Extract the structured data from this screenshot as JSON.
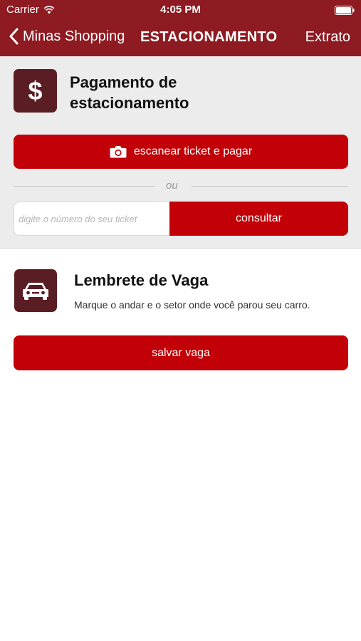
{
  "status_bar": {
    "carrier": "Carrier",
    "time": "4:05 PM"
  },
  "nav": {
    "back_label": "Minas Shopping",
    "title": "ESTACIONAMENTO",
    "extrato": "Extrato"
  },
  "payment": {
    "icon_symbol": "$",
    "title": "Pagamento de estacionamento",
    "scan_button": "escanear ticket e pagar",
    "divider_text": "ou",
    "ticket_placeholder": "digite o número do seu ticket",
    "ticket_value": "",
    "consult_button": "consultar"
  },
  "reminder": {
    "title": "Lembrete de Vaga",
    "description": "Marque o andar e o setor onde você parou seu carro.",
    "save_button": "salvar vaga"
  },
  "colors": {
    "nav_bg": "#8e1b22",
    "button_red": "#c10007",
    "icon_box": "#5a1d23",
    "section_bg": "#ececec"
  },
  "icons": {
    "wifi": "wifi-icon",
    "battery": "battery-icon",
    "back": "chevron-left-icon",
    "dollar": "dollar-icon",
    "camera": "camera-icon",
    "car": "car-icon"
  }
}
